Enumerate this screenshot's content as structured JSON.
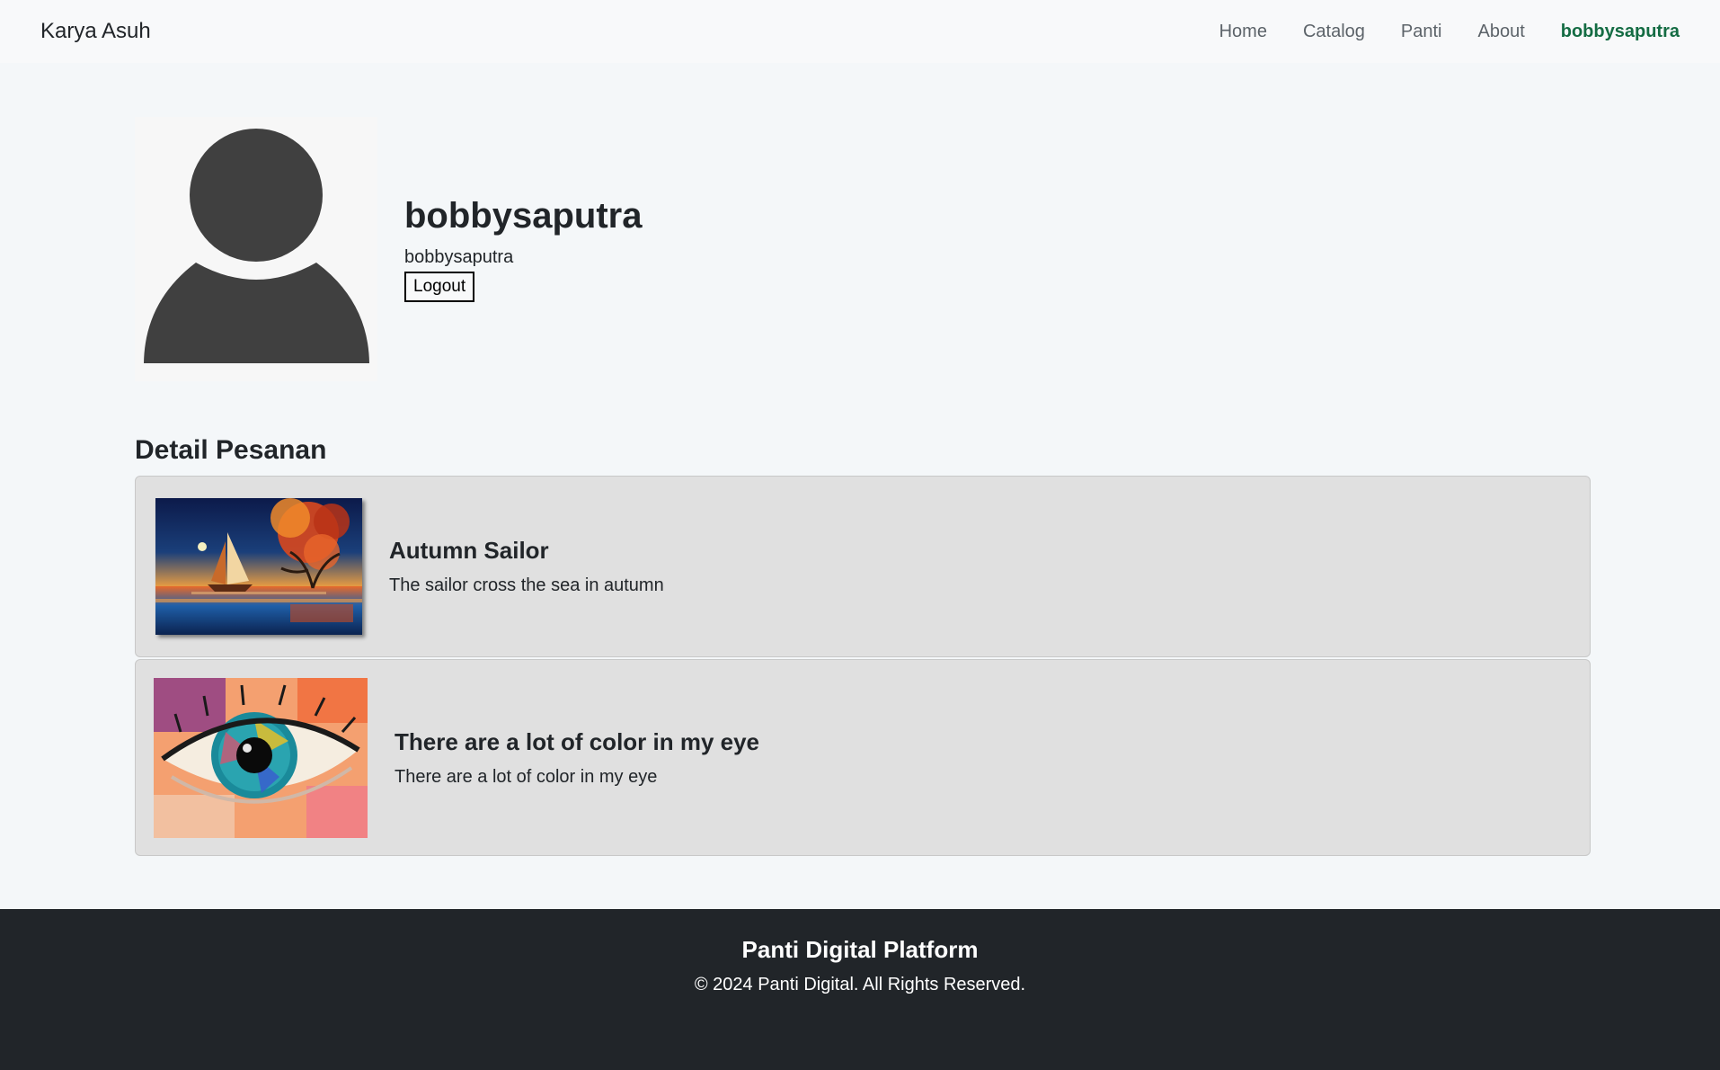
{
  "navbar": {
    "brand": "Karya Asuh",
    "links": [
      {
        "label": "Home"
      },
      {
        "label": "Catalog"
      },
      {
        "label": "Panti"
      },
      {
        "label": "About"
      },
      {
        "label": "bobbysaputra",
        "active": true
      }
    ],
    "accent_color": "#146c43"
  },
  "profile": {
    "avatar_icon": "user-silhouette-icon",
    "name": "bobbysaputra",
    "username": "bobbysaputra",
    "logout_label": "Logout"
  },
  "orders": {
    "section_title": "Detail Pesanan",
    "items": [
      {
        "image": "sailboat-autumn-painting",
        "title": "Autumn Sailor",
        "description": "The sailor cross the sea in autumn"
      },
      {
        "image": "colorful-eye-painting",
        "title": "There are a lot of color in my eye",
        "description": "There are a lot of color in my eye"
      }
    ]
  },
  "footer": {
    "title": "Panti Digital Platform",
    "copyright": "© 2024 Panti Digital. All Rights Reserved.",
    "background": "#212529"
  }
}
